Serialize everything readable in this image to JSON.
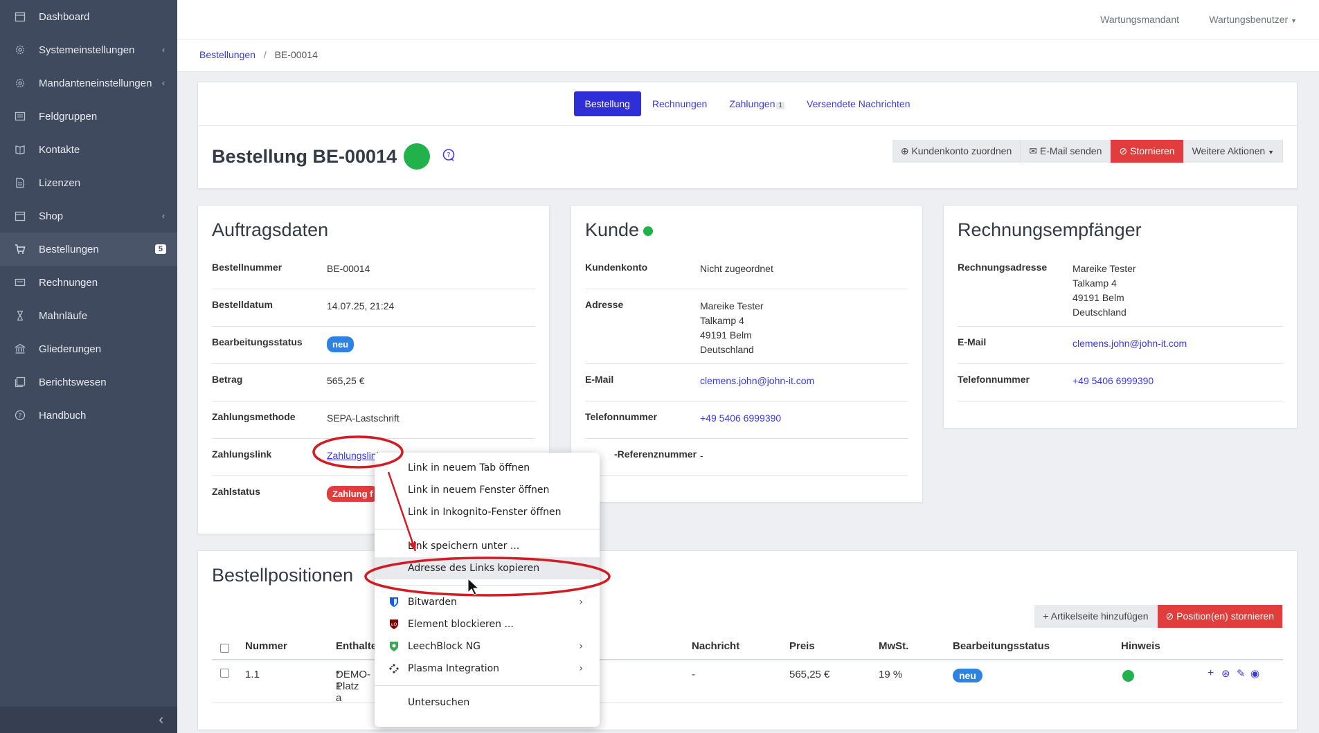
{
  "sidebar": {
    "items": [
      {
        "label": "Dashboard",
        "icon": "calendar-icon"
      },
      {
        "label": "Systemeinstellungen",
        "icon": "gear-icon"
      },
      {
        "label": "Mandanteneinstellungen",
        "icon": "gear-icon"
      },
      {
        "label": "Feldgruppen",
        "icon": "list-icon"
      },
      {
        "label": "Kontakte",
        "icon": "book-icon"
      },
      {
        "label": "Lizenzen",
        "icon": "document-icon"
      },
      {
        "label": "Shop",
        "icon": "calendar-icon"
      },
      {
        "label": "Bestellungen",
        "icon": "cart-icon",
        "badge": "5"
      },
      {
        "label": "Rechnungen",
        "icon": "receipt-icon"
      },
      {
        "label": "Mahnläufe",
        "icon": "hourglass-icon"
      },
      {
        "label": "Gliederungen",
        "icon": "bank-icon"
      },
      {
        "label": "Berichtswesen",
        "icon": "report-icon"
      },
      {
        "label": "Handbuch",
        "icon": "help-icon"
      }
    ]
  },
  "topbar": {
    "tenant": "Wartungsmandant",
    "user": "Wartungsbenutzer"
  },
  "breadcrumb": {
    "parent": "Bestellungen",
    "current": "BE-00014"
  },
  "tabs": {
    "order": "Bestellung",
    "invoices": "Rechnungen",
    "payments": "Zahlungen",
    "payments_count": "1",
    "messages": "Versendete Nachrichten"
  },
  "header": {
    "title": "Bestellung BE-00014"
  },
  "actions": {
    "assign": "Kundenkonto zuordnen",
    "email": "E-Mail senden",
    "cancel": "Stornieren",
    "more": "Weitere Aktionen"
  },
  "order_data": {
    "title": "Auftragsdaten",
    "number_label": "Bestellnummer",
    "number": "BE-00014",
    "date_label": "Bestelldatum",
    "date": "14.07.25, 21:24",
    "status_label": "Bearbeitungsstatus",
    "status": "neu",
    "amount_label": "Betrag",
    "amount": "565,25 €",
    "method_label": "Zahlungsmethode",
    "method": "SEPA-Lastschrift",
    "link_label": "Zahlungslink",
    "link": "Zahlungslink",
    "paystatus_label": "Zahlstatus",
    "paystatus": "Zahlung f"
  },
  "customer": {
    "title": "Kunde",
    "account_label": "Kundenkonto",
    "account": "Nicht zugeordnet",
    "address_label": "Adresse",
    "address": [
      "Mareike Tester",
      "Talkamp 4",
      "49191 Belm",
      "Deutschland"
    ],
    "email_label": "E-Mail",
    "email": "clemens.john@john-it.com",
    "phone_label": "Telefonnummer",
    "phone": "+49 5406 6999390",
    "vat_label": "-Referenznummer",
    "vat": "-"
  },
  "recipient": {
    "title": "Rechnungsempfänger",
    "address_label": "Rechnungsadresse",
    "address": [
      "Mareike Tester",
      "Talkamp 4",
      "49191 Belm",
      "Deutschland"
    ],
    "email_label": "E-Mail",
    "email": "clemens.john@john-it.com",
    "phone_label": "Telefonnummer",
    "phone": "+49 5406 6999390"
  },
  "positions": {
    "title": "Bestellpositionen",
    "add_button": "Artikelseite hinzufügen",
    "cancel_button": "Position(en) stornieren",
    "columns": {
      "number": "Nummer",
      "contains": "Enthalte",
      "message": "Nachricht",
      "price": "Preis",
      "vat": "MwSt.",
      "status": "Bearbeitungsstatus",
      "hint": "Hinweis"
    },
    "row": {
      "number": "1.1",
      "contains": "DEMO-1",
      "contains2": "* Platz a",
      "message": "-",
      "price": "565,25 €",
      "vat": "19 %",
      "status": "neu"
    }
  },
  "context_menu": {
    "items": [
      {
        "label": "Link in neuem Tab öffnen"
      },
      {
        "label": "Link in neuem Fenster öffnen"
      },
      {
        "label": "Link in Inkognito-Fenster öffnen"
      },
      {
        "label": "Link speichern unter ..."
      },
      {
        "label": "Adresse des Links kopieren"
      },
      {
        "label": "Bitwarden",
        "icon": "bitwarden-icon"
      },
      {
        "label": "Element blockieren ...",
        "icon": "ublock-icon"
      },
      {
        "label": "LeechBlock NG",
        "icon": "leechblock-icon"
      },
      {
        "label": "Plasma Integration",
        "icon": "plasma-icon"
      },
      {
        "label": "Untersuchen"
      }
    ]
  },
  "colors": {
    "primary": "#2f2fd8",
    "danger": "#e23d3d",
    "success": "#22b24c",
    "sidebar": "#3f4a5e",
    "annotation": "#d01c24"
  }
}
